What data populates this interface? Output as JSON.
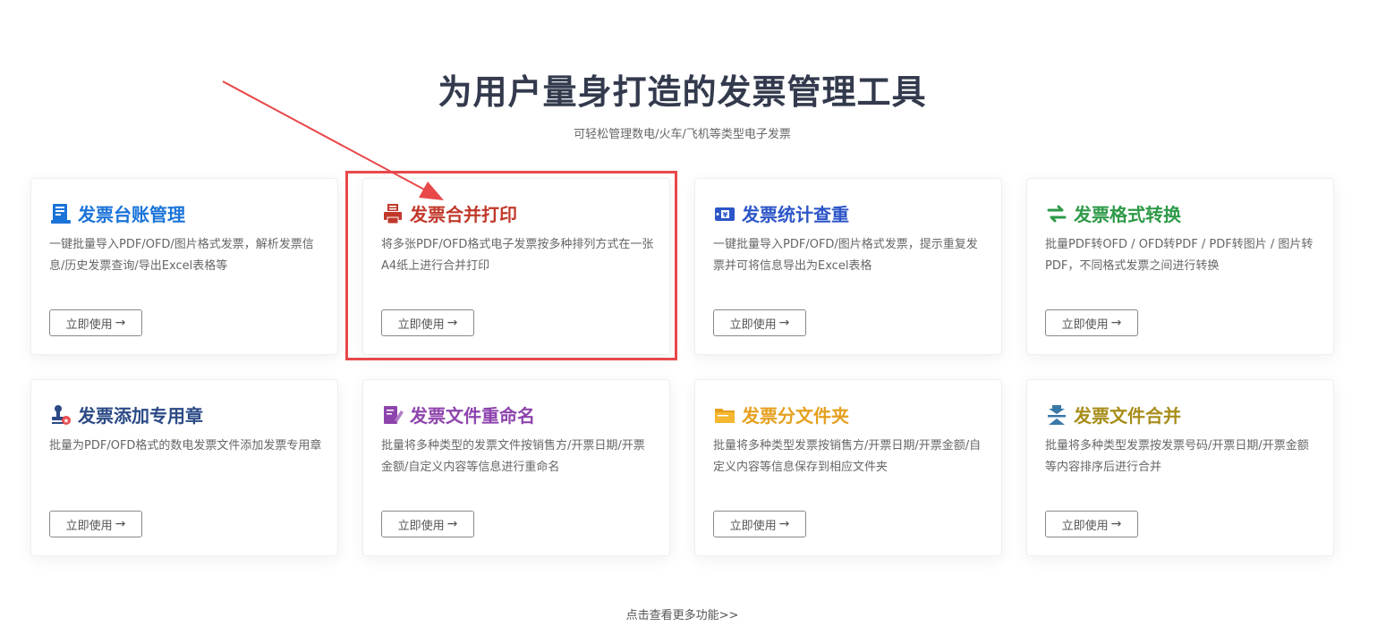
{
  "header": {
    "title": "为用户量身打造的发票管理工具",
    "subtitle": "可轻松管理数电/火车/飞机等类型电子发票"
  },
  "cards": [
    {
      "title": "发票台账管理",
      "color": "#1a73d9",
      "icon": "ledger-icon",
      "desc": "一键批量导入PDF/OFD/图片格式发票，解析发票信息/历史发票查询/导出Excel表格等",
      "button": "立即使用"
    },
    {
      "title": "发票合并打印",
      "color": "#c0392b",
      "icon": "printer-icon",
      "desc": "将多张PDF/OFD格式电子发票按多种排列方式在一张A4纸上进行合并打印",
      "button": "立即使用"
    },
    {
      "title": "发票统计查重",
      "color": "#2c55c8",
      "icon": "invoice-stats-icon",
      "desc": "一键批量导入PDF/OFD/图片格式发票，提示重复发票并可将信息导出为Excel表格",
      "button": "立即使用"
    },
    {
      "title": "发票格式转换",
      "color": "#2e9a48",
      "icon": "convert-arrows-icon",
      "desc": "批量PDF转OFD / OFD转PDF / PDF转图片 / 图片转PDF，不同格式发票之间进行转换",
      "button": "立即使用"
    },
    {
      "title": "发票添加专用章",
      "color": "#2b4a86",
      "icon": "stamp-icon",
      "desc": "批量为PDF/OFD格式的数电发票文件添加发票专用章",
      "button": "立即使用"
    },
    {
      "title": "发票文件重命名",
      "color": "#8e44ad",
      "icon": "rename-pen-icon",
      "desc": "批量将多种类型的发票文件按销售方/开票日期/开票金额/自定义内容等信息进行重命名",
      "button": "立即使用"
    },
    {
      "title": "发票分文件夹",
      "color": "#e6a020",
      "icon": "folder-icon",
      "desc": "批量将多种类型发票按销售方/开票日期/开票金额/自定义内容等信息保存到相应文件夹",
      "button": "立即使用"
    },
    {
      "title": "发票文件合并",
      "color": "#a88d1a",
      "icon": "merge-icon",
      "desc": "批量将多种类型发票按发票号码/开票日期/开票金额等内容排序后进行合并",
      "button": "立即使用"
    }
  ],
  "button_arrow": "→",
  "more_link": "点击查看更多功能>>",
  "colors": {
    "annotation": "#e8484a",
    "title_text": "#333a4d",
    "body_text": "#666666"
  }
}
